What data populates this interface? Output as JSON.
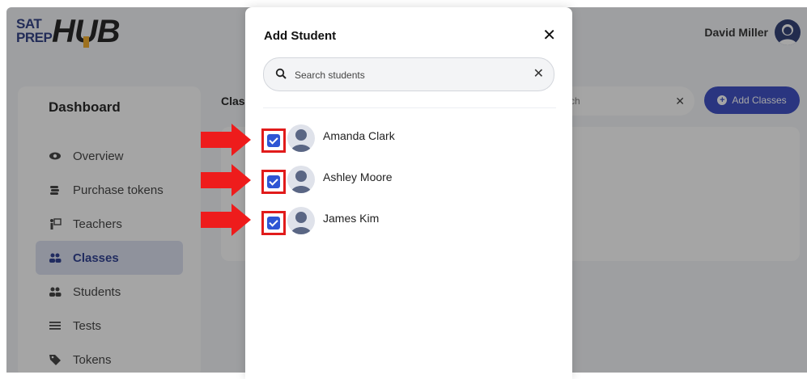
{
  "header": {
    "logo_sat": "SAT",
    "logo_prep": "PREP",
    "logo_hub": "HUB",
    "user_name": "David Miller"
  },
  "sidebar": {
    "title": "Dashboard",
    "items": [
      {
        "label": "Overview",
        "icon": "eye-icon"
      },
      {
        "label": "Purchase tokens",
        "icon": "coins-icon"
      },
      {
        "label": "Teachers",
        "icon": "teacher-icon"
      },
      {
        "label": "Classes",
        "icon": "users-icon",
        "active": true
      },
      {
        "label": "Students",
        "icon": "users-icon"
      },
      {
        "label": "Tests",
        "icon": "list-icon"
      },
      {
        "label": "Tokens",
        "icon": "tag-icon"
      }
    ]
  },
  "main": {
    "heading": "Clas",
    "search_text": "ch",
    "add_classes_label": "Add Classes"
  },
  "modal": {
    "title": "Add Student",
    "close_label": "✕",
    "search_placeholder": "Search students",
    "students": [
      {
        "name": "Amanda Clark",
        "checked": true
      },
      {
        "name": "Ashley Moore",
        "checked": true
      },
      {
        "name": "James Kim",
        "checked": true
      }
    ]
  },
  "colors": {
    "accent": "#2b3fbf",
    "checkbox": "#2f55d4",
    "highlight": "#e11b1b",
    "active_nav_bg": "#d9def0"
  }
}
